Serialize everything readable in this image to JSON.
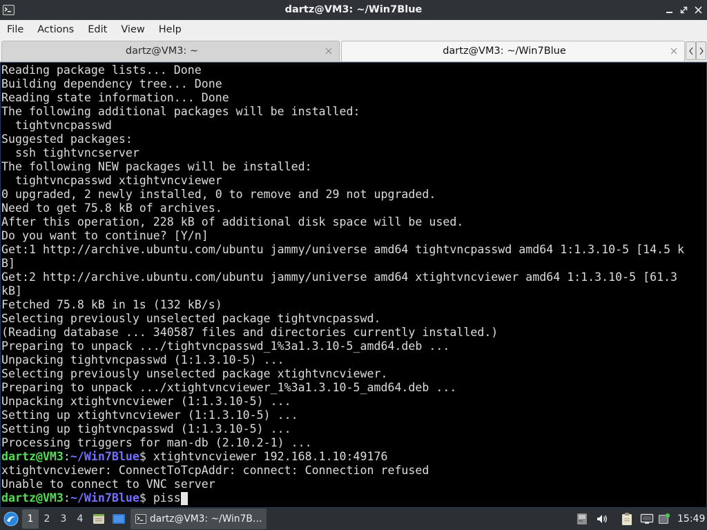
{
  "colors": {
    "titlebar_bg": "#2f3337",
    "menubar_bg": "#efefef",
    "terminal_bg": "#000000",
    "terminal_fg": "#dcdcdc",
    "prompt_user": "#55dd55",
    "prompt_path": "#7272ff",
    "taskbar_bg": "#2c3034"
  },
  "window": {
    "title": "dartz@VM3: ~/Win7Blue",
    "app_icon": "terminal-icon",
    "controls": [
      "minimize-icon",
      "maximize-icon",
      "close-icon"
    ]
  },
  "menubar": {
    "items": [
      "File",
      "Actions",
      "Edit",
      "View",
      "Help"
    ]
  },
  "tabs": [
    {
      "label": "dartz@VM3: ~",
      "active": false,
      "close_icon": "close-tab-icon"
    },
    {
      "label": "dartz@VM3: ~/Win7Blue",
      "active": true,
      "close_icon": "close-tab-icon"
    }
  ],
  "tab_scroll": [
    "chevron-left-icon",
    "chevron-right-icon"
  ],
  "terminal": {
    "lines": [
      "Reading package lists... Done",
      "Building dependency tree... Done",
      "Reading state information... Done",
      "The following additional packages will be installed:",
      "  tightvncpasswd",
      "Suggested packages:",
      "  ssh tightvncserver",
      "The following NEW packages will be installed:",
      "  tightvncpasswd xtightvncviewer",
      "0 upgraded, 2 newly installed, 0 to remove and 29 not upgraded.",
      "Need to get 75.8 kB of archives.",
      "After this operation, 228 kB of additional disk space will be used.",
      "Do you want to continue? [Y/n]",
      "Get:1 http://archive.ubuntu.com/ubuntu jammy/universe amd64 tightvncpasswd amd64 1:1.3.10-5 [14.5 k",
      "B]",
      "Get:2 http://archive.ubuntu.com/ubuntu jammy/universe amd64 xtightvncviewer amd64 1:1.3.10-5 [61.3",
      "kB]",
      "Fetched 75.8 kB in 1s (132 kB/s)",
      "Selecting previously unselected package tightvncpasswd.",
      "(Reading database ... 340587 files and directories currently installed.)",
      "Preparing to unpack .../tightvncpasswd_1%3a1.3.10-5_amd64.deb ...",
      "Unpacking tightvncpasswd (1:1.3.10-5) ...",
      "Selecting previously unselected package xtightvncviewer.",
      "Preparing to unpack .../xtightvncviewer_1%3a1.3.10-5_amd64.deb ...",
      "Unpacking xtightvncviewer (1:1.3.10-5) ...",
      "Setting up xtightvncviewer (1:1.3.10-5) ...",
      "Setting up tightvncpasswd (1:1.3.10-5) ...",
      "Processing triggers for man-db (2.10.2-1) ...",
      {
        "user_host": "dartz@VM3",
        "separator": ":",
        "path": "~/Win7Blue",
        "symbol": "$ ",
        "command": "xtightvncviewer 192.168.1.10:49176"
      },
      "xtightvncviewer: ConnectToTcpAddr: connect: Connection refused",
      "Unable to connect to VNC server",
      {
        "user_host": "dartz@VM3",
        "separator": ":",
        "path": "~/Win7Blue",
        "symbol": "$ ",
        "command": "piss"
      }
    ]
  },
  "taskbar": {
    "menu_icon": "start-menu-icon",
    "desktops": [
      "1",
      "2",
      "3",
      "4"
    ],
    "active_desktop": 1,
    "quick_launch": [
      "file-manager-icon",
      "show-desktop-icon"
    ],
    "task": {
      "icon": "terminal-icon",
      "label": "dartz@VM3: ~/Win7B…",
      "active": true
    },
    "tray": [
      "notification-icon",
      "volume-icon",
      "clipboard-icon",
      "network-icon",
      "update-notifier-icon"
    ],
    "clock": "15:49"
  }
}
